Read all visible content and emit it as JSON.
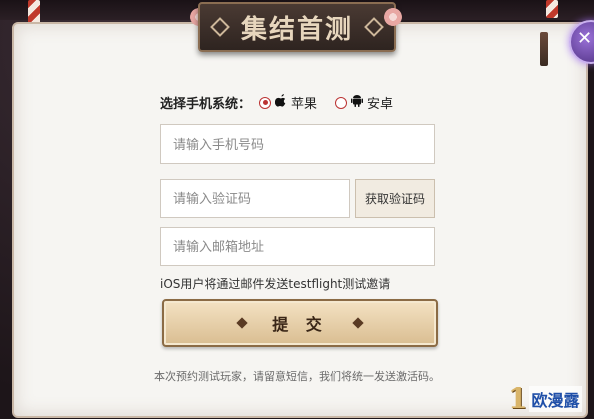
{
  "title": "集结首测",
  "os_select": {
    "label": "选择手机系统：",
    "options": [
      {
        "label": "苹果",
        "icon": "apple-icon",
        "selected": true
      },
      {
        "label": "安卓",
        "icon": "android-icon",
        "selected": false
      }
    ]
  },
  "form": {
    "phone_placeholder": "请输入手机号码",
    "code_placeholder": "请输入验证码",
    "get_code_label": "获取验证码",
    "email_placeholder": "请输入邮箱地址",
    "note": "iOS用户将通过邮件发送testflight测试邀请",
    "submit_label": "提 交"
  },
  "footer": "本次预约测试玩家，请留意短信，我们将统一发送激活码。",
  "watermark": {
    "number": "1",
    "text": "欧漫露"
  },
  "colors": {
    "paper": "#f6f5f2",
    "banner": "#3a2d28",
    "accent_red": "#b33333",
    "submit_gold": "#d9bd91"
  }
}
